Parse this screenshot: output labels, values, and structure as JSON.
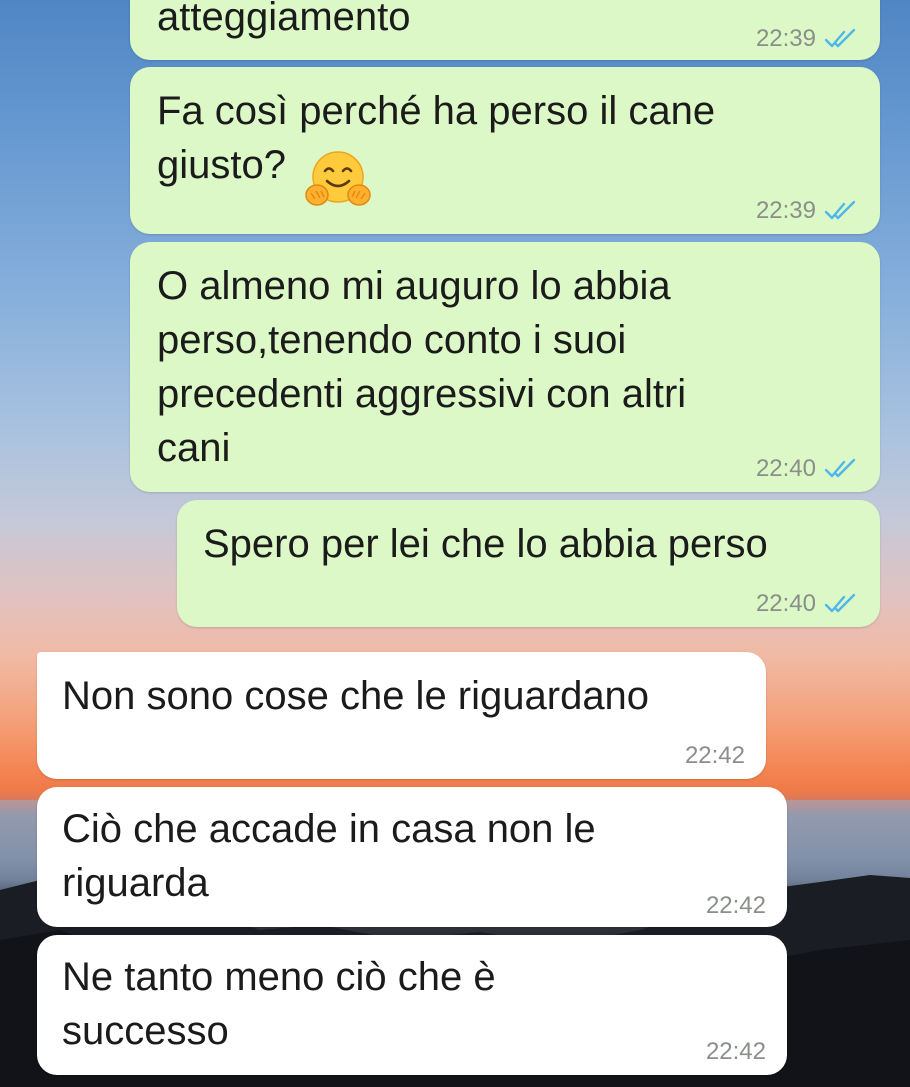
{
  "colors": {
    "outgoing_bubble": "#dcf8c6",
    "incoming_bubble": "#ffffff",
    "read_ticks": "#4fb6ec",
    "timestamp": "#8a8f8a"
  },
  "messages": [
    {
      "direction": "outgoing",
      "text": "atteggiamento",
      "time": "22:39",
      "status": "read-double-tick-icon"
    },
    {
      "direction": "outgoing",
      "text": "Fa così perché ha perso il cane\ngiusto?",
      "emoji": "hugging-face-emoji",
      "time": "22:39",
      "status": "read-double-tick-icon"
    },
    {
      "direction": "outgoing",
      "text": "O almeno mi auguro lo abbia\nperso,tenendo conto i suoi\nprecedenti aggressivi con altri\ncani",
      "time": "22:40",
      "status": "read-double-tick-icon"
    },
    {
      "direction": "outgoing",
      "text": "Spero per lei che lo abbia perso",
      "time": "22:40",
      "status": "read-double-tick-icon"
    },
    {
      "direction": "incoming",
      "text": "Non sono cose che le riguardano",
      "time": "22:42"
    },
    {
      "direction": "incoming",
      "text": "Ciò che accade in casa non le\nriguarda",
      "time": "22:42"
    },
    {
      "direction": "incoming",
      "text": "Ne tanto meno ciò che è\nsuccesso",
      "time": "22:42"
    }
  ]
}
